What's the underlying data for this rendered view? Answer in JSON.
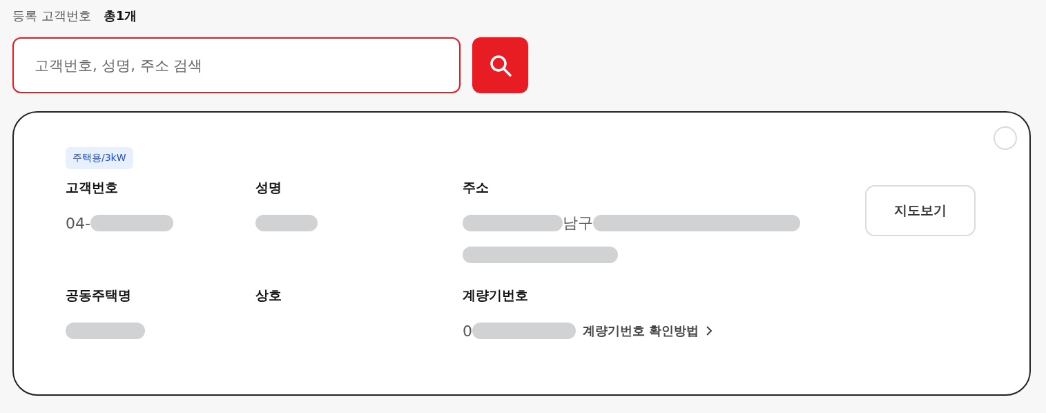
{
  "header": {
    "label": "등록 고객번호",
    "count": "총1개"
  },
  "search": {
    "placeholder": "고객번호, 성명, 주소 검색"
  },
  "card": {
    "selected": false,
    "tag": "주택용/3kW",
    "map_button": "지도보기",
    "fields": [
      {
        "label": "고객번호",
        "lines": [
          [
            {
              "kind": "text",
              "text": "04-"
            },
            {
              "kind": "redacted"
            }
          ]
        ]
      },
      {
        "label": "성명",
        "lines": [
          [
            {
              "kind": "redacted"
            }
          ]
        ]
      },
      {
        "label": "주소",
        "lines": [
          [
            {
              "kind": "redacted"
            },
            {
              "kind": "text",
              "text": "남구"
            },
            {
              "kind": "redacted"
            }
          ],
          [
            {
              "kind": "redacted"
            }
          ]
        ]
      },
      {
        "label": "공동주택명",
        "lines": [
          [
            {
              "kind": "redacted"
            }
          ]
        ]
      },
      {
        "label": "상호"
      },
      {
        "label": "계량기번호",
        "lines": [
          [
            {
              "kind": "text",
              "text": "0"
            },
            {
              "kind": "redacted"
            }
          ]
        ],
        "link": "계량기번호 확인방법"
      }
    ]
  }
}
